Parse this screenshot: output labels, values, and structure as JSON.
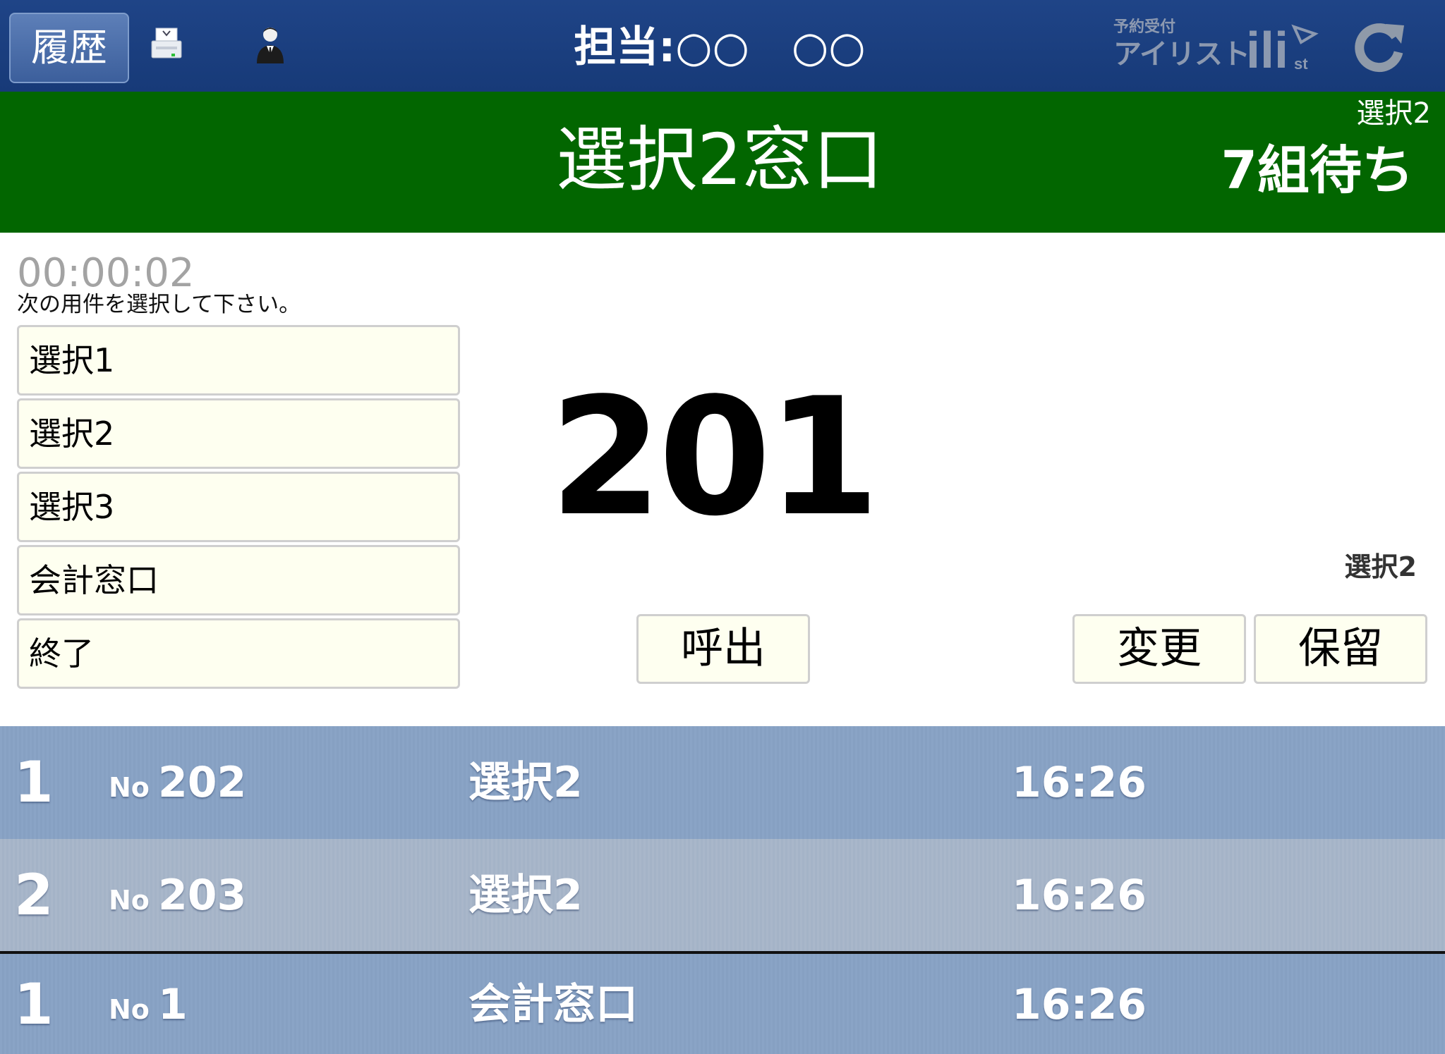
{
  "topbar": {
    "history_label": "履歴",
    "staff_label": "担当:○○　○○",
    "brand_small": "予約受付",
    "brand_main": "アイリスト",
    "brand_mark": "ili",
    "icons": [
      "printer-icon",
      "staff-icon",
      "refresh-icon"
    ]
  },
  "header": {
    "window_title": "選択2窓口",
    "wait_category": "選択2",
    "wait_count": "7組待ち"
  },
  "main": {
    "timer": "00:00:02",
    "instruction": "次の用件を選択して下さい。",
    "menu": [
      {
        "label": "選択1"
      },
      {
        "label": "選択2"
      },
      {
        "label": "選択3"
      },
      {
        "label": "会計窓口"
      },
      {
        "label": "終了"
      }
    ],
    "ticket_number": "201",
    "current_category": "選択2",
    "call_label": "呼出",
    "change_label": "変更",
    "hold_label": "保留"
  },
  "queue": [
    {
      "rank": "1",
      "prefix": "No",
      "number": "202",
      "category": "選択2",
      "time": "16:26"
    },
    {
      "rank": "2",
      "prefix": "No",
      "number": "203",
      "category": "選択2",
      "time": "16:26"
    },
    {
      "rank": "1",
      "prefix": "No",
      "number": "1",
      "category": "会計窓口",
      "time": "16:26"
    }
  ],
  "colors": {
    "topbar": "#1f4487",
    "header_green": "#026600",
    "button_bg": "#fefff0",
    "row_blue": "#8aa4c6",
    "row_grey": "#a9b7ca"
  }
}
